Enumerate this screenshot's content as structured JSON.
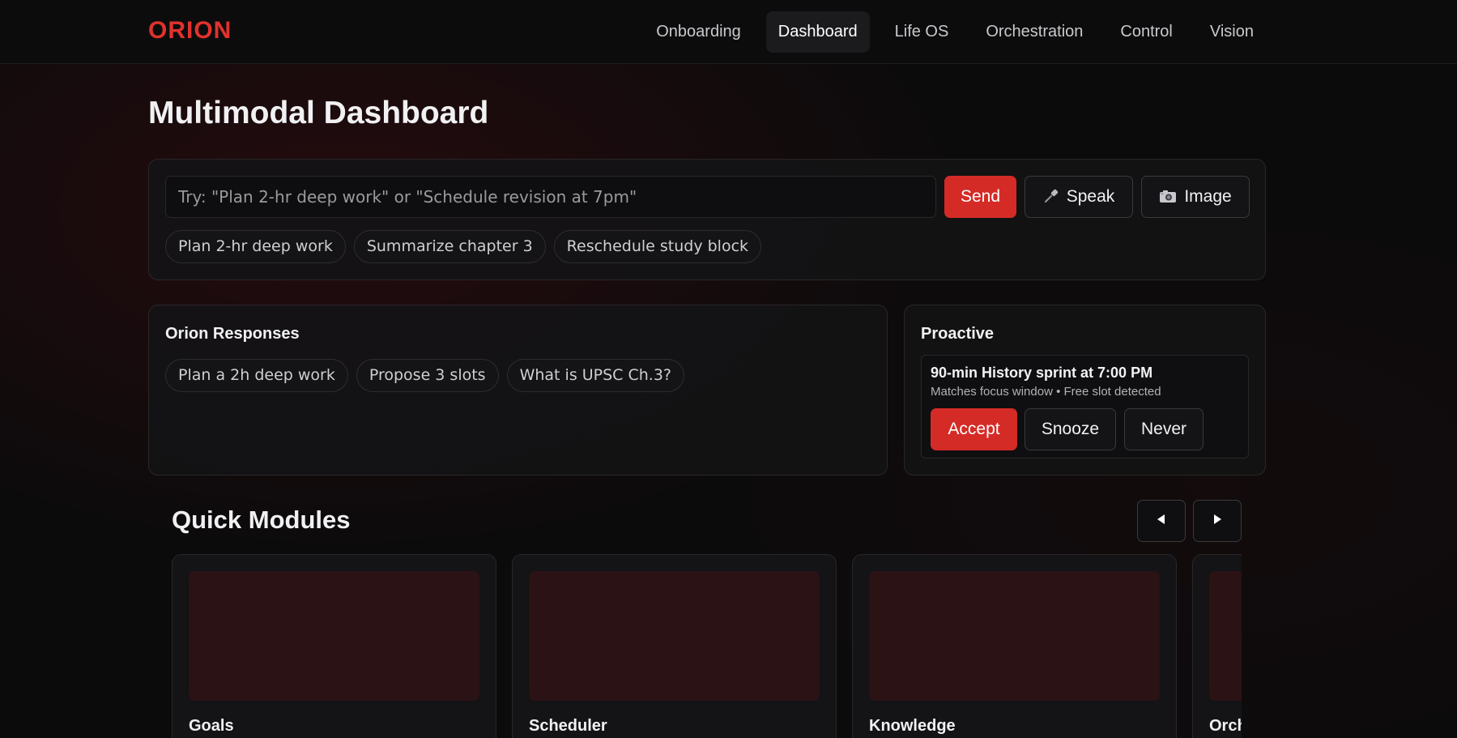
{
  "nav": {
    "logo": "ORION",
    "items": [
      {
        "label": "Onboarding"
      },
      {
        "label": "Dashboard",
        "active": true
      },
      {
        "label": "Life OS"
      },
      {
        "label": "Orchestration"
      },
      {
        "label": "Control"
      },
      {
        "label": "Vision"
      }
    ]
  },
  "page": {
    "title": "Multimodal Dashboard"
  },
  "composer": {
    "placeholder": "Try: \"Plan 2-hr deep work\" or \"Schedule revision at 7pm\"",
    "value": "",
    "send_label": "Send",
    "speak_label": "Speak",
    "speak_icon": "microphone-icon",
    "image_label": "Image",
    "image_icon": "camera-icon",
    "quick_prompts": [
      "Plan 2-hr deep work",
      "Summarize chapter 3",
      "Reschedule study block"
    ]
  },
  "responses": {
    "heading": "Orion Responses",
    "chips": [
      "Plan a 2h deep work",
      "Propose 3 slots",
      "What is UPSC Ch.3?"
    ]
  },
  "proactive": {
    "heading": "Proactive",
    "suggestion": {
      "title": "90-min History sprint at 7:00 PM",
      "meta": "Matches focus window • Free slot detected",
      "accept_label": "Accept",
      "snooze_label": "Snooze",
      "never_label": "Never"
    }
  },
  "quick_modules": {
    "title": "Quick Modules",
    "prev_icon": "chevron-left-icon",
    "next_icon": "chevron-right-icon",
    "modules": [
      {
        "name": "Goals"
      },
      {
        "name": "Scheduler"
      },
      {
        "name": "Knowledge"
      },
      {
        "name": "Orchestration"
      }
    ]
  },
  "colors": {
    "brand": "#e0322d",
    "primary_button": "#d42b27",
    "module_thumb": "#2a1215",
    "background": "#0c0b0c"
  }
}
